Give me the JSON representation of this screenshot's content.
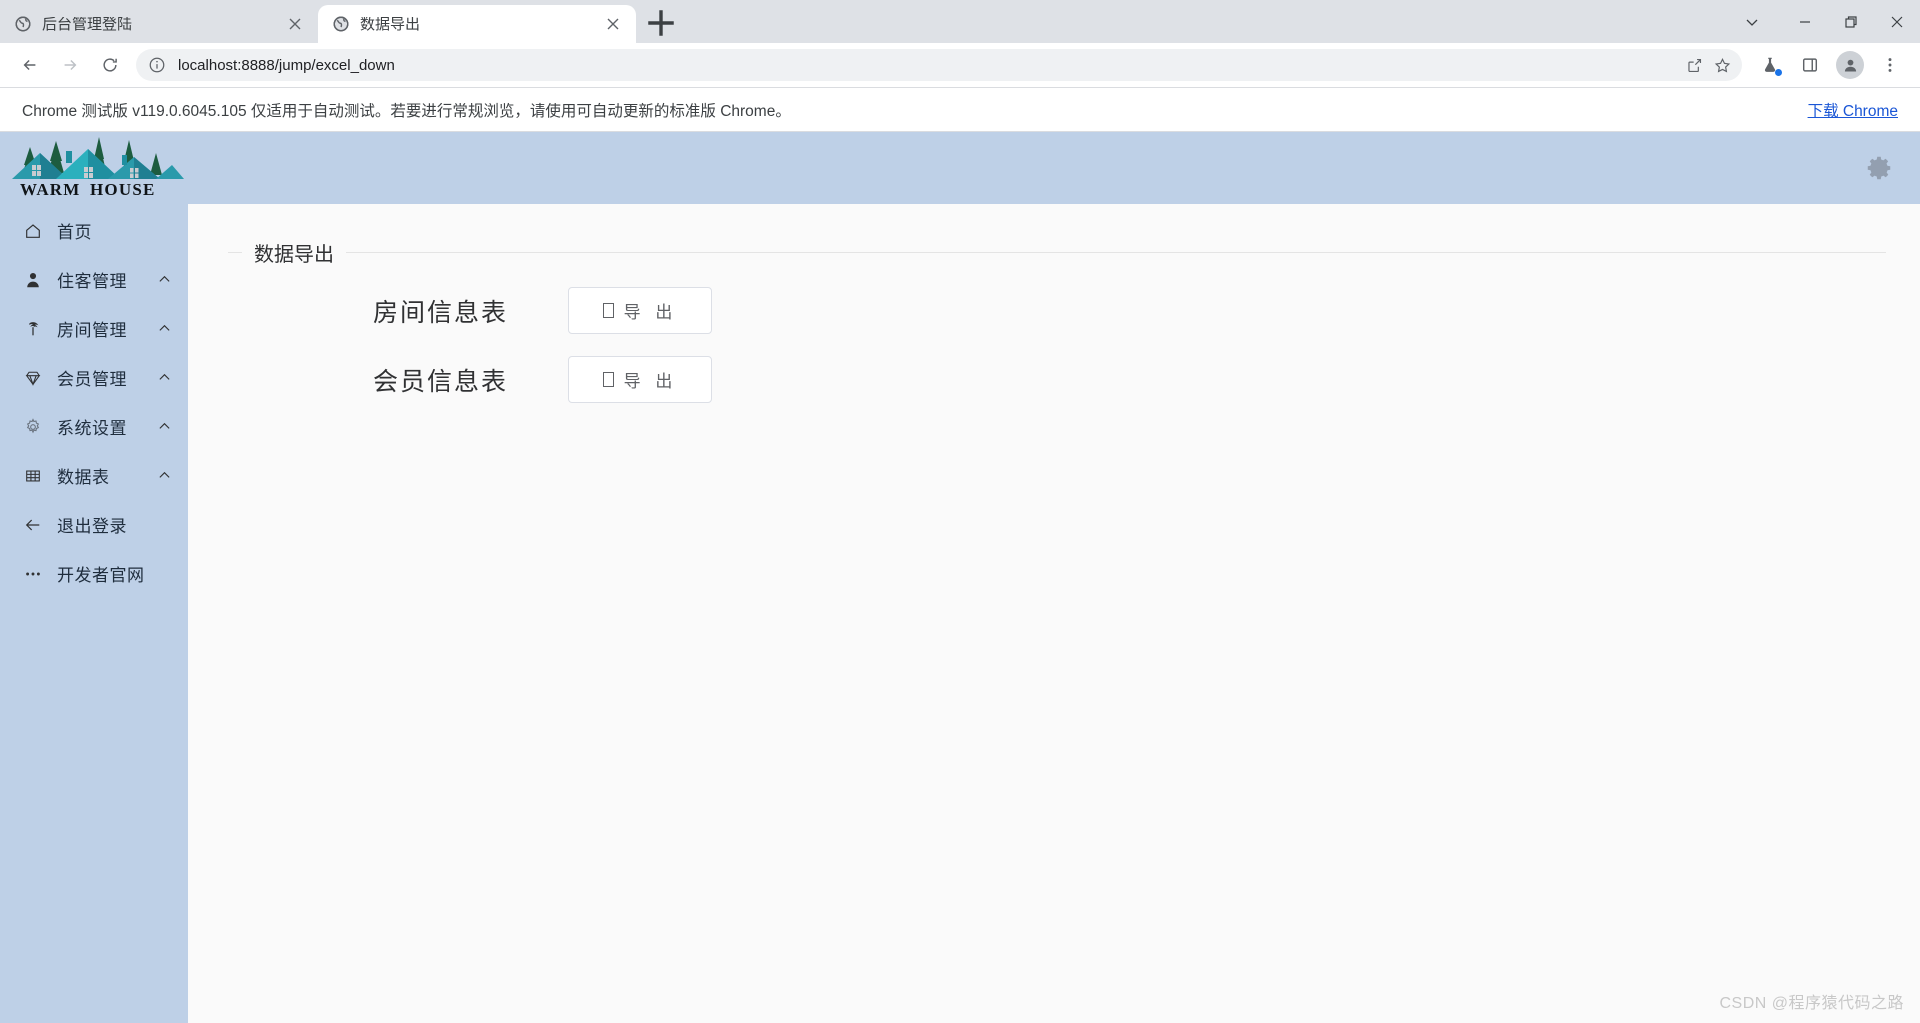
{
  "browser": {
    "tabs": [
      {
        "title": "后台管理登陆",
        "favicon": "globe-icon",
        "active": false
      },
      {
        "title": "数据导出",
        "favicon": "globe-icon",
        "active": true
      }
    ],
    "new_tab_label": "+",
    "window_controls": {
      "tab_search": "chevron-down-icon",
      "minimize": "minimize-icon",
      "maximize": "restore-icon",
      "close": "close-icon"
    },
    "nav": {
      "back": "back-arrow-icon",
      "forward": "forward-arrow-icon",
      "reload": "reload-icon"
    },
    "omnibox": {
      "site_info_icon": "info-circle-icon",
      "url": "localhost:8888/jump/excel_down",
      "share_icon": "share-icon",
      "bookmark_icon": "star-icon"
    },
    "toolbar_icons": {
      "experiments": "flask-icon",
      "side_panel": "side-panel-icon",
      "profile": "avatar-icon",
      "menu": "three-dot-menu-icon"
    },
    "infobar": {
      "message": "Chrome 测试版 v119.0.6045.105 仅适用于自动测试。若要进行常规浏览，请使用可自动更新的标准版 Chrome。",
      "download_link": "下载 Chrome"
    }
  },
  "app": {
    "logo": {
      "text_left": "WARM",
      "text_right": "HOUSE",
      "roof_color": "#2a9aab",
      "tree_color": "#1d5c3f"
    },
    "sidebar": {
      "bg_color": "#bed0e7",
      "items": [
        {
          "label": "首页",
          "icon": "home-icon",
          "arrow": false
        },
        {
          "label": "住客管理",
          "icon": "user-icon",
          "arrow": true
        },
        {
          "label": "房间管理",
          "icon": "tree-icon",
          "arrow": true
        },
        {
          "label": "会员管理",
          "icon": "diamond-icon",
          "arrow": true
        },
        {
          "label": "系统设置",
          "icon": "gear-icon",
          "arrow": true
        },
        {
          "label": "数据表",
          "icon": "table-icon",
          "arrow": true
        },
        {
          "label": "退出登录",
          "icon": "logout-arrow-icon",
          "arrow": false
        },
        {
          "label": "开发者官网",
          "icon": "ellipsis-icon",
          "arrow": false
        }
      ]
    },
    "topbar": {
      "settings_icon": "gear-icon"
    },
    "main": {
      "panel_title": "数据导出",
      "rows": [
        {
          "label": "房间信息表",
          "button_label": "导 出",
          "button_icon": "tofu-box-glyph"
        },
        {
          "label": "会员信息表",
          "button_label": "导 出",
          "button_icon": "tofu-box-glyph"
        }
      ]
    },
    "watermark": "CSDN @程序猿代码之路"
  }
}
